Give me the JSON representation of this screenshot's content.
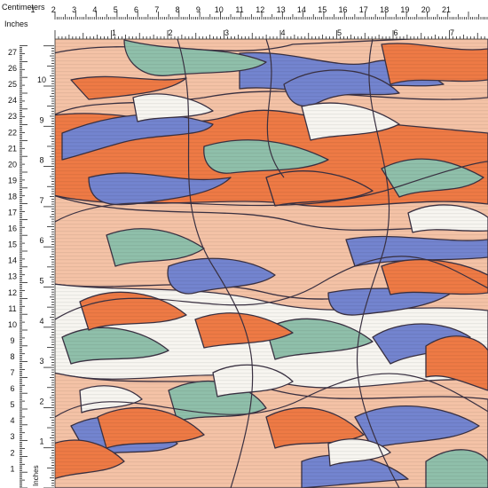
{
  "rulers": {
    "top_unit_label": "Centimeters",
    "left_unit_label": "Inches",
    "corner_inches_label": "Inches",
    "top_cm_numbers": [
      "1",
      "2",
      "3",
      "4",
      "5",
      "6",
      "7",
      "8",
      "9",
      "10",
      "11",
      "12",
      "13",
      "14",
      "15",
      "16",
      "17",
      "18",
      "19",
      "20",
      "21"
    ],
    "top_in_numbers": [
      "1",
      "2",
      "3",
      "4",
      "5",
      "6",
      "7",
      "8"
    ],
    "left_cm_numbers": [
      "27",
      "26",
      "25",
      "24",
      "23",
      "22",
      "21",
      "20",
      "19",
      "18",
      "17",
      "16",
      "15",
      "14",
      "13",
      "12",
      "11",
      "10",
      "9",
      "8",
      "7",
      "6",
      "5",
      "4",
      "3",
      "2",
      "1"
    ],
    "left_in_numbers": [
      "10",
      "9",
      "8",
      "7",
      "6",
      "5",
      "4",
      "3",
      "2",
      "1"
    ],
    "left_bottom_inches_label": "Inches"
  },
  "fabric": {
    "pattern": "abstract swirl print",
    "colors": {
      "orange": "#ee7a45",
      "peach": "#f4c2a6",
      "sage": "#8fbfaa",
      "periwinkle": "#7384cf",
      "white": "#f7f5f0",
      "outline": "#3a3142"
    }
  }
}
